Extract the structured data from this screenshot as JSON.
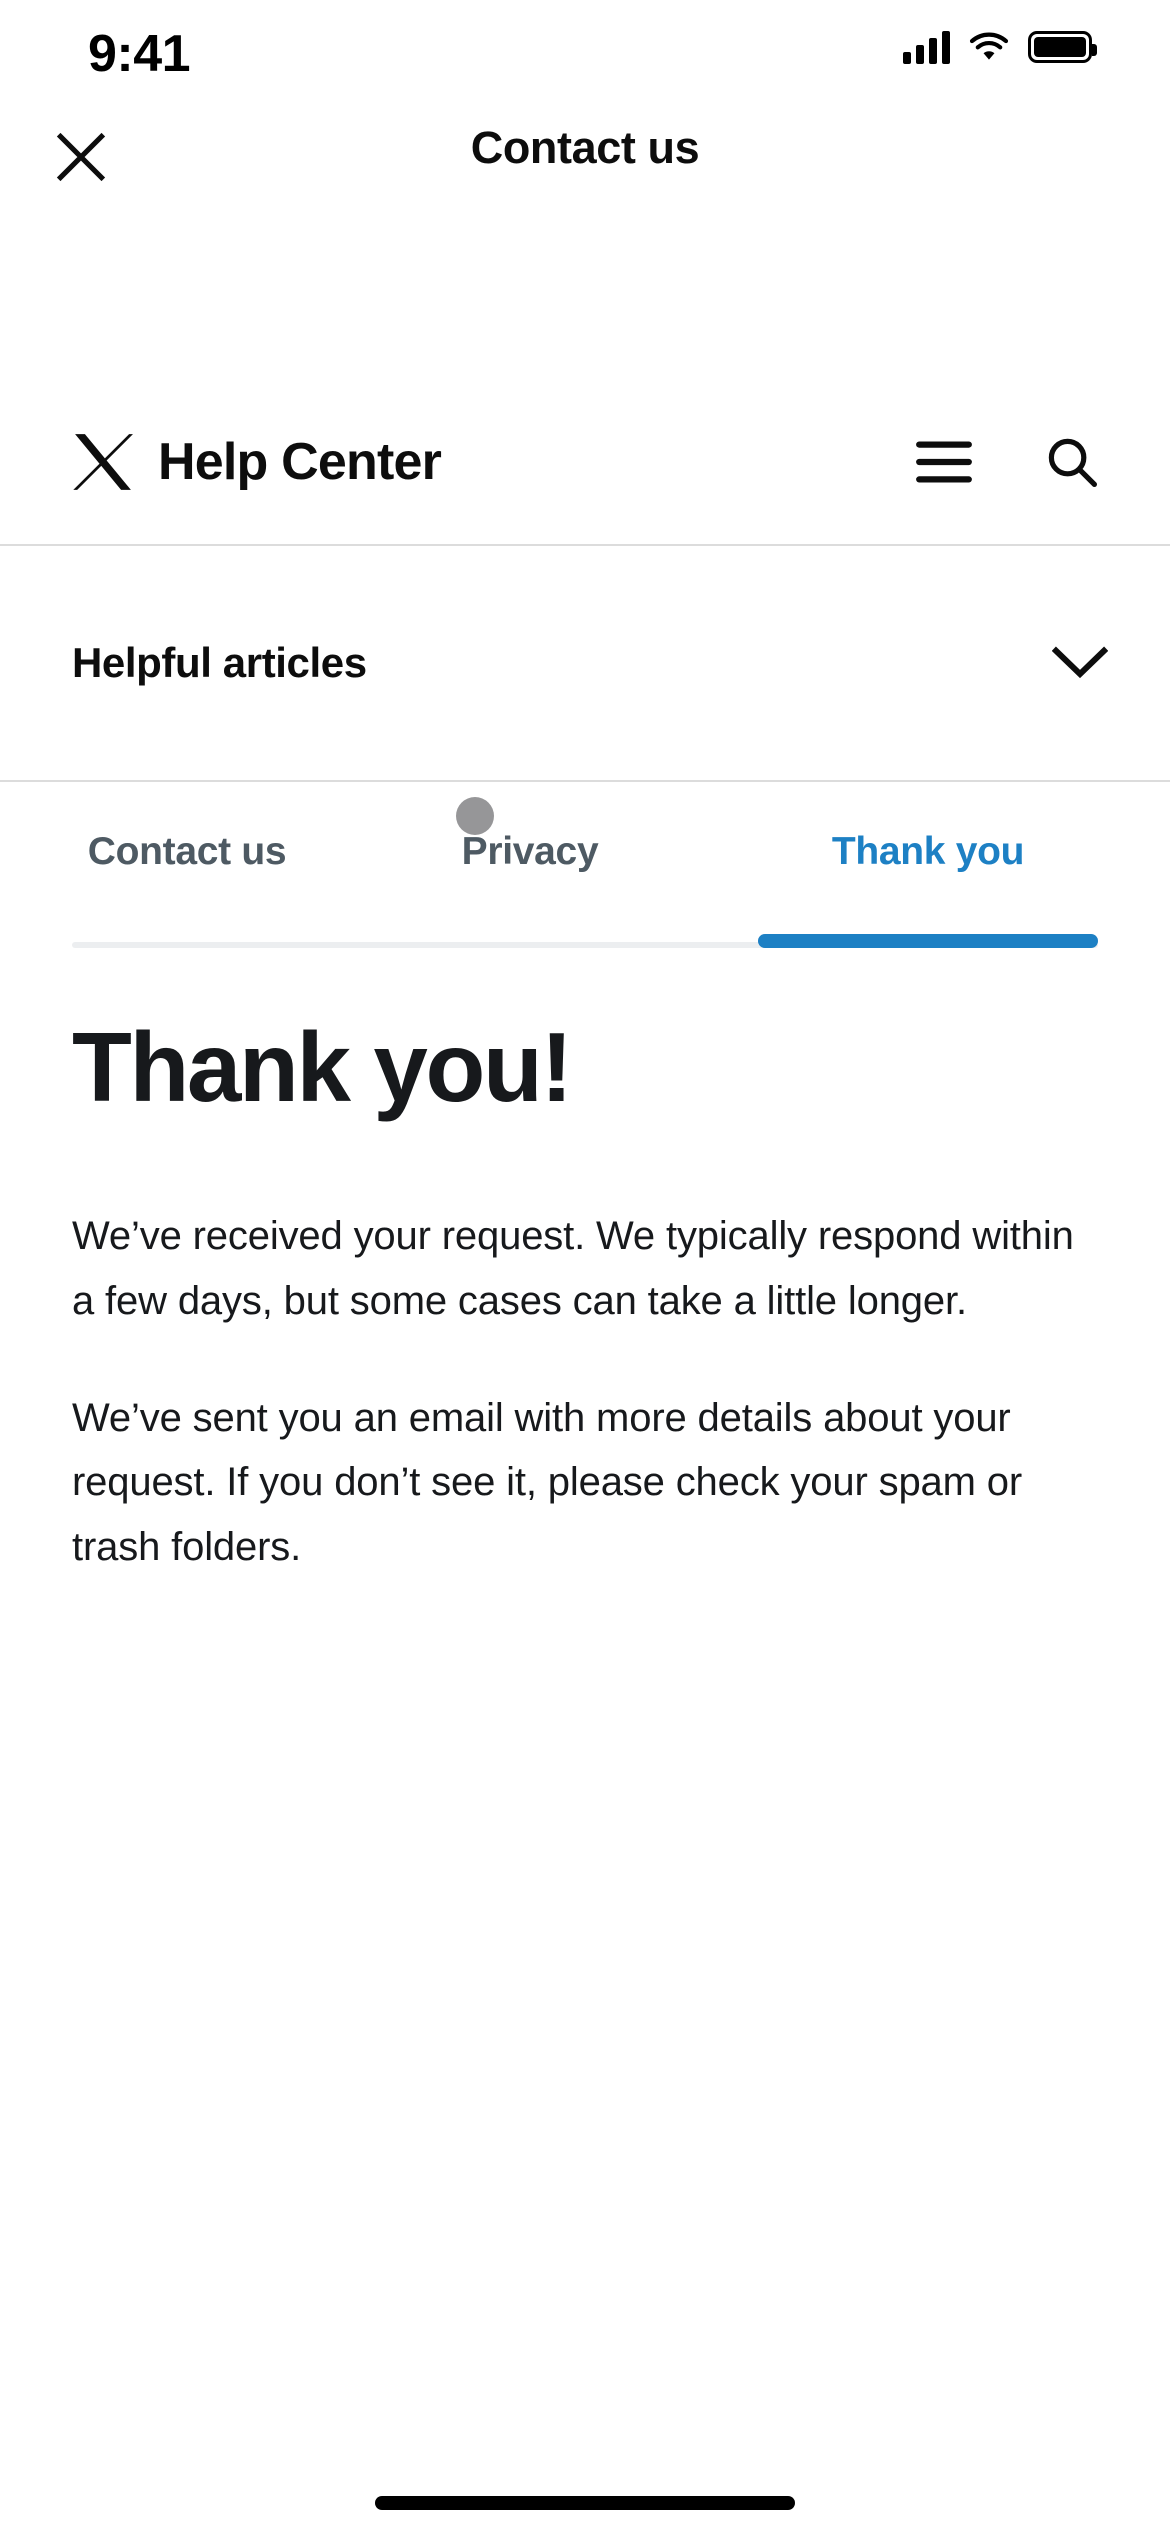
{
  "status_bar": {
    "time": "9:41",
    "cellular_icon": "cellular-signal-icon",
    "wifi_icon": "wifi-icon",
    "battery_icon": "battery-full-icon"
  },
  "nav_bar": {
    "close_icon": "close-icon",
    "title": "Contact us"
  },
  "help_center_header": {
    "logo_icon": "x-logo-icon",
    "title": "Help Center",
    "menu_icon": "hamburger-menu-icon",
    "search_icon": "search-icon"
  },
  "accordion": {
    "label": "Helpful articles",
    "chevron_icon": "chevron-down-icon",
    "expanded": "false"
  },
  "tabs": {
    "items": [
      {
        "label": "Contact us",
        "active": "false"
      },
      {
        "label": "Privacy",
        "active": "false"
      },
      {
        "label": "Thank you",
        "active": "true"
      }
    ],
    "active_index": "2",
    "active_color": "#1d80c4",
    "inactive_color": "#4e5a63",
    "track_color": "#eceef0"
  },
  "main": {
    "heading": "Thank you!",
    "paragraphs": [
      "We’ve received your request. We typically respond within a few days, but some cases can take a little longer.",
      "We’ve sent you an email with more details about your request. If you don’t see it, please check your spam or trash folders."
    ]
  },
  "overlay": {
    "touch_indicator": "touch-point-indicator",
    "touch_color": "#6e6e70"
  },
  "system": {
    "home_indicator": "home-indicator-bar"
  },
  "theme": {
    "background": "#ffffff",
    "text": "#17191c",
    "divider": "#dcdcdc",
    "accent": "#1d80c4"
  }
}
